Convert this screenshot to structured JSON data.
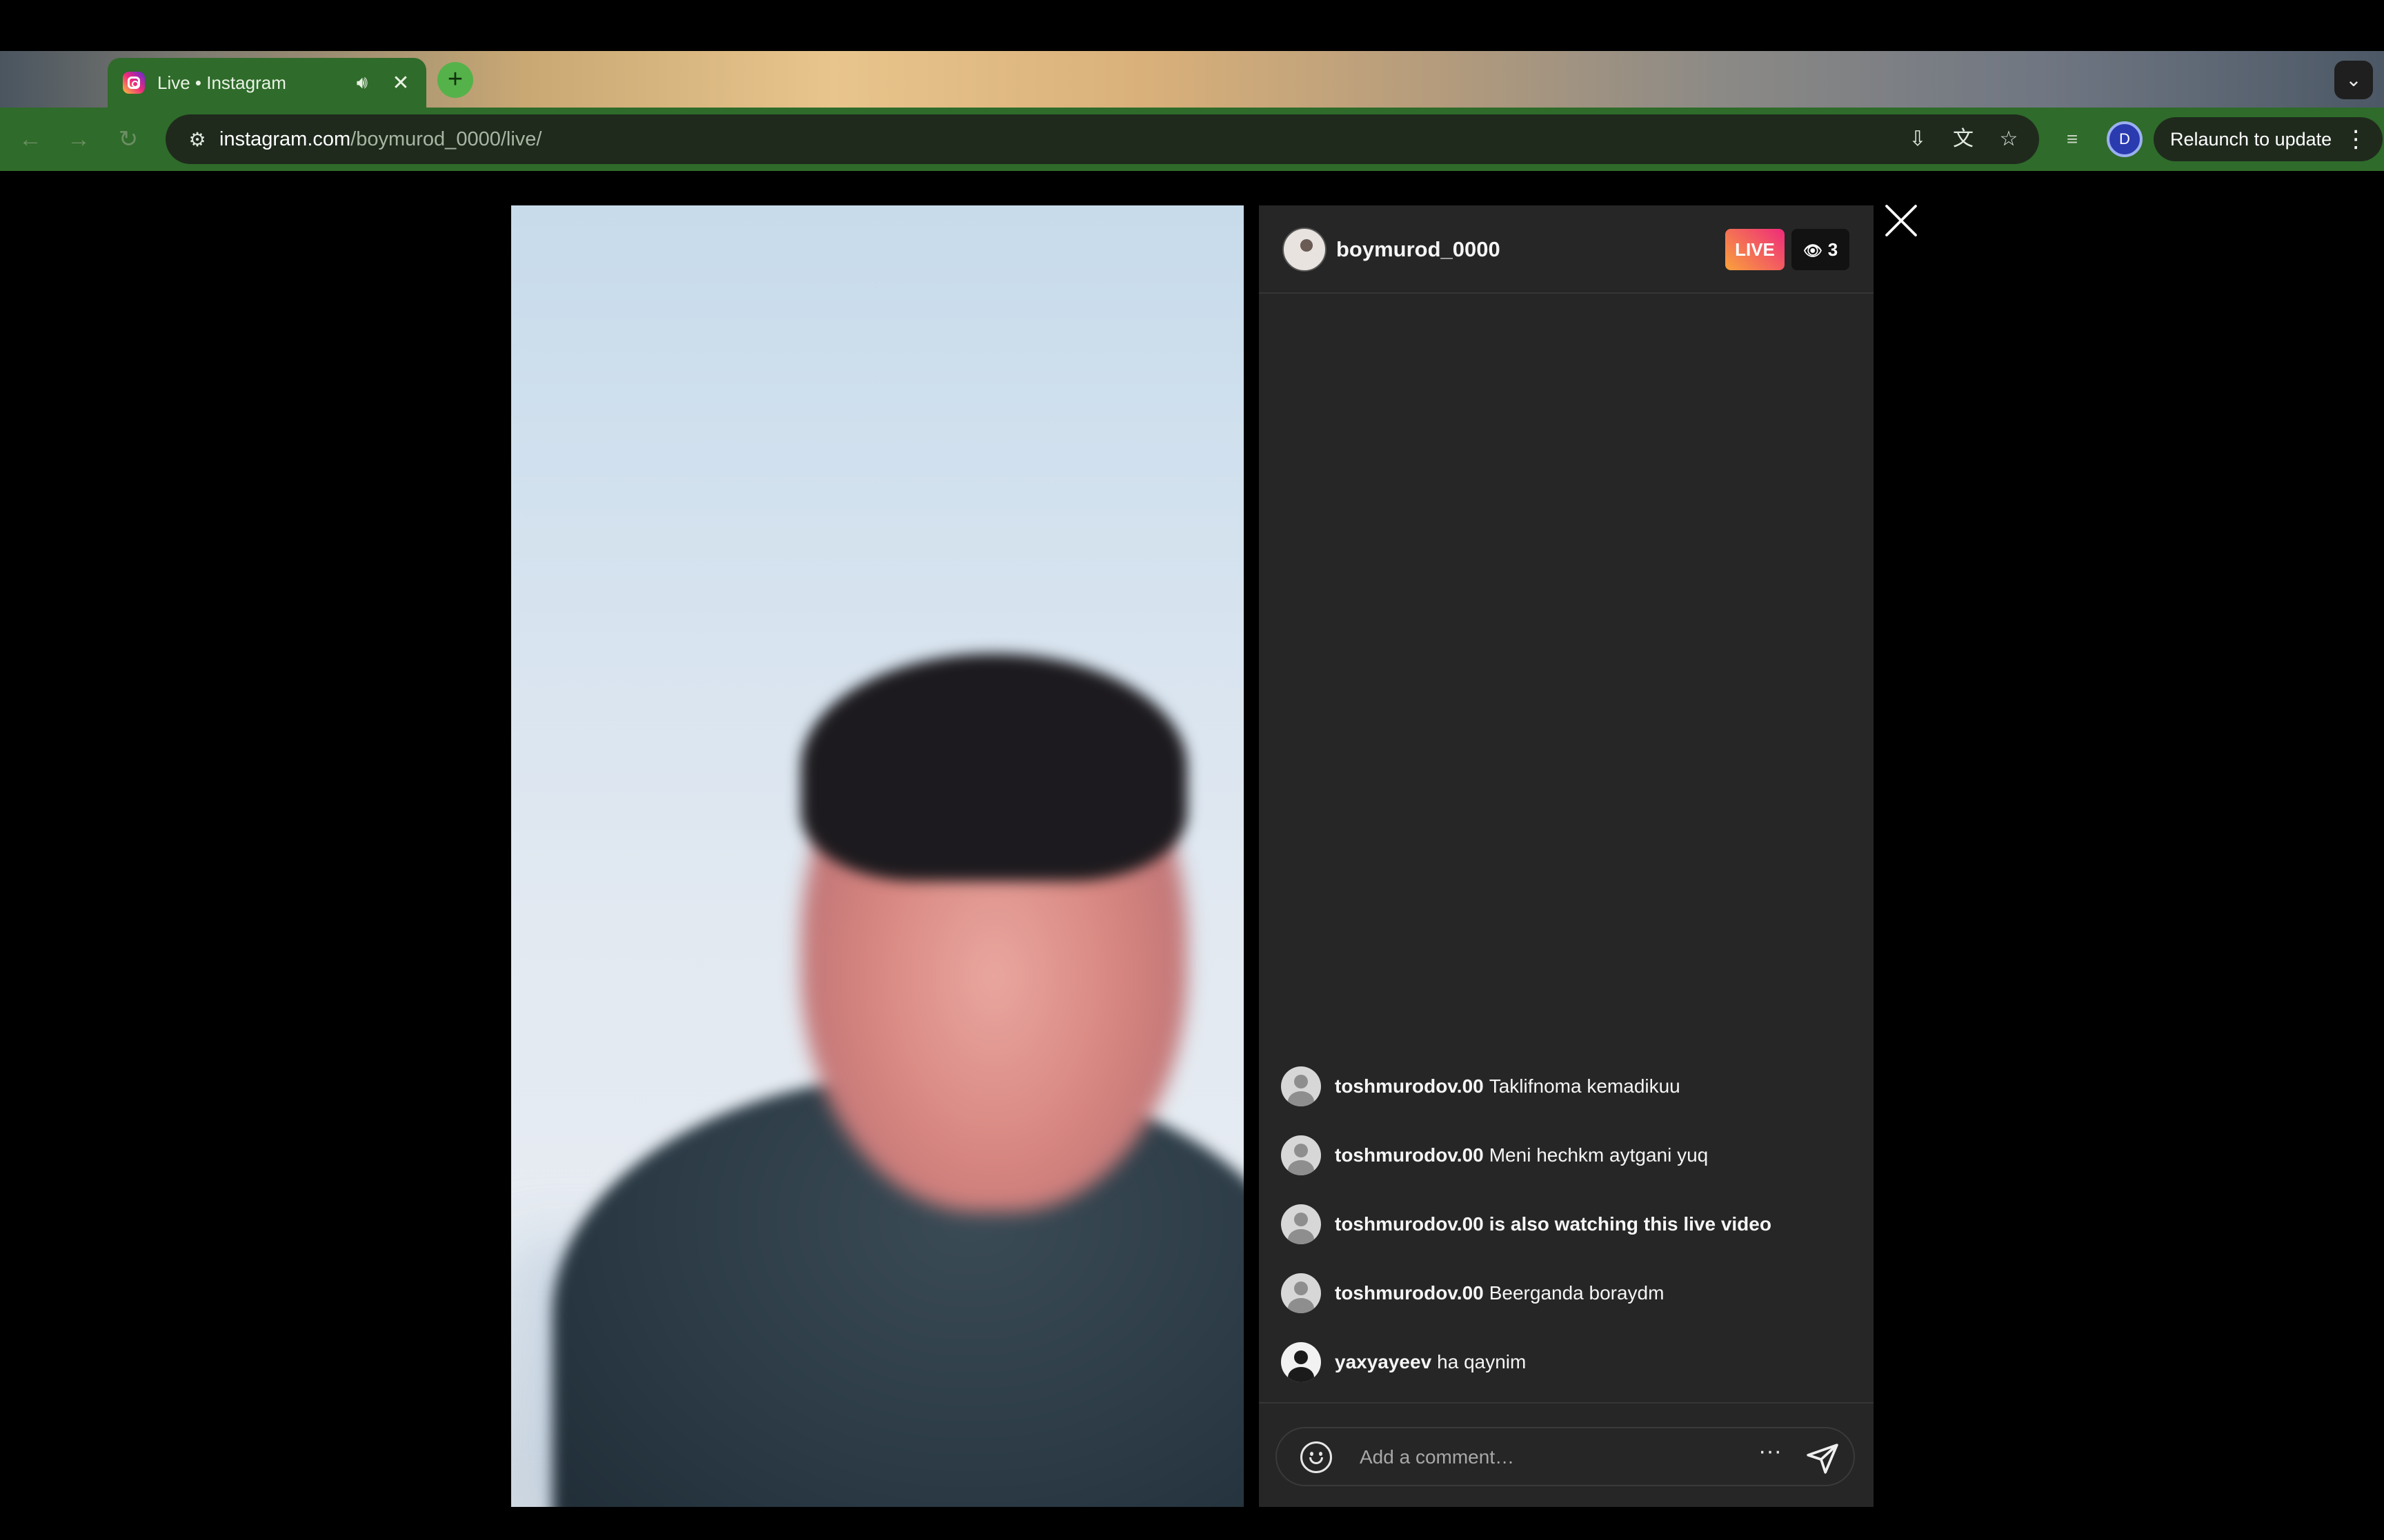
{
  "browser": {
    "tab": {
      "title": "Live • Instagram",
      "audio_icon": "speaker-icon",
      "close_glyph": "✕"
    },
    "new_tab_glyph": "+",
    "tab_search_glyph": "⌄",
    "url_host": "instagram.com",
    "url_path": "/boymurod_0000/live/",
    "profile_initial": "D",
    "relaunch_label": "Relaunch to update",
    "menu_glyph": "⋮"
  },
  "live": {
    "host_username": "boymurod_0000",
    "live_badge": "LIVE",
    "viewer_count": "3",
    "comments": [
      {
        "user": "toshmurodov.00",
        "text": "Taklifnoma kemadikuu",
        "bold": false,
        "avatar": "default"
      },
      {
        "user": "toshmurodov.00",
        "text": "Meni hechkm aytgani yuq",
        "bold": false,
        "avatar": "default"
      },
      {
        "user": "toshmurodov.00",
        "text": "is also watching this live video",
        "bold": true,
        "avatar": "default"
      },
      {
        "user": "toshmurodov.00",
        "text": "Beerganda boraydm",
        "bold": false,
        "avatar": "default"
      },
      {
        "user": "yaxyayeev",
        "text": "ha qaynim",
        "bold": false,
        "avatar": "photo"
      }
    ],
    "comment_placeholder": "Add a comment…",
    "more_glyph": "···"
  },
  "colors": {
    "tab_bg": "#2f6b2a",
    "panel_bg": "#262626",
    "live_gradient_start": "#f9a23b",
    "live_gradient_end": "#ee2a7b"
  }
}
